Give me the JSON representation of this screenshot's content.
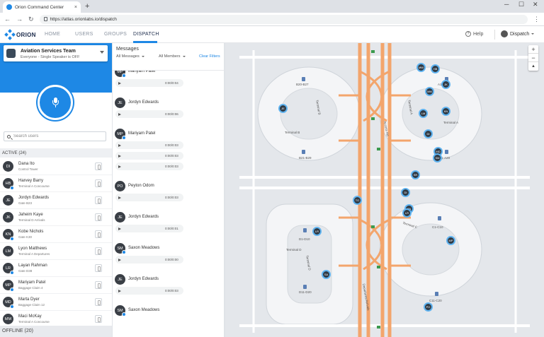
{
  "browser": {
    "tab_title": "Orion Command Center",
    "url": "https://atlas.orionlabs.io/dispatch",
    "new_tab": "+",
    "close_tab": "×"
  },
  "header": {
    "logo_text": "ORION",
    "nav": [
      "HOME",
      "USERS",
      "GROUPS",
      "DISPATCH"
    ],
    "help_label": "Help",
    "user_menu": "Dispatch"
  },
  "team": {
    "name": "Aviation Services Team",
    "subtitle": "Everyone - Single Speaker is OFF"
  },
  "search": {
    "placeholder": "Search users"
  },
  "sections": {
    "active": "ACTIVE (24)",
    "offline": "OFFLINE (20)"
  },
  "users": [
    {
      "initials": "DI",
      "name": "Dana Ito",
      "location": "Control Tower",
      "badge": false
    },
    {
      "initials": "HB",
      "name": "Harvey Barry",
      "location": "Terminal A Concourse",
      "badge": true
    },
    {
      "initials": "JE",
      "name": "Jordyn Edwards",
      "location": "Gate B23",
      "badge": false
    },
    {
      "initials": "JK",
      "name": "Jaheim Kaye",
      "location": "Terminal D Arrivals",
      "badge": false
    },
    {
      "initials": "KN",
      "name": "Kobe Nichols",
      "location": "Gate K30",
      "badge": true
    },
    {
      "initials": "LM",
      "name": "Lyon Matthews",
      "location": "Terminal A Departures",
      "badge": false
    },
    {
      "initials": "LR",
      "name": "Layan Rahman",
      "location": "Gate D38",
      "badge": true
    },
    {
      "initials": "MP",
      "name": "Mariyam Patel",
      "location": "Baggage Claim 4",
      "badge": true
    },
    {
      "initials": "MD",
      "name": "Marta Dyer",
      "location": "Baggage Claim 12",
      "badge": true
    },
    {
      "initials": "MM",
      "name": "Maci McKay",
      "location": "Terminal A Concourse",
      "badge": false
    }
  ],
  "messages": {
    "title": "Messages",
    "filter_messages": "All Messages",
    "filter_members": "All Members",
    "clear_filters": "Clear Filters",
    "items": [
      {
        "initials": "MP",
        "name": "Mariyam Patel",
        "badge": true,
        "players": [
          "0:00/0:04"
        ]
      },
      {
        "initials": "JE",
        "name": "Jordyn Edwards",
        "badge": false,
        "players": [
          "0:00/0:06"
        ]
      },
      {
        "initials": "MP",
        "name": "Mariyam Patel",
        "badge": true,
        "players": [
          "0:00/0:03",
          "0:00/0:03",
          "0:00/0:03"
        ]
      },
      {
        "initials": "PO",
        "name": "Peyton Odom",
        "badge": false,
        "players": [
          "0:00/0:03"
        ]
      },
      {
        "initials": "JE",
        "name": "Jordyn Edwards",
        "badge": false,
        "players": [
          "0:00/0:01"
        ]
      },
      {
        "initials": "SM",
        "name": "Saxon Meadows",
        "badge": true,
        "players": [
          "0:00/0:00"
        ]
      },
      {
        "initials": "JE",
        "name": "Jordyn Edwards",
        "badge": false,
        "players": [
          "0:00/0:03"
        ]
      },
      {
        "initials": "SM",
        "name": "Saxon Meadows",
        "badge": true,
        "players": []
      }
    ]
  },
  "map": {
    "zoom_in": "+",
    "zoom_out": "−",
    "compass": "▲",
    "labels": [
      "Terminal B",
      "Terminal A",
      "Terminal C",
      "Terminal D",
      "Access Rd",
      "Departures/Arrivals",
      "Terminal B",
      "Terminal A",
      "B20-B27",
      "B21-B29",
      "A1-A10",
      "A11-A20",
      "C1-C10",
      "C11-C20",
      "D1-D10",
      "D11-D20",
      "Terminal D"
    ],
    "markers": [
      "MW",
      "HB",
      "JK",
      "MM",
      "KN",
      "JE",
      "LM",
      "DI",
      "MD",
      "SM",
      "SR",
      "DI",
      "KN",
      "LR",
      "LR",
      "MP",
      "PO",
      "TO",
      "SA"
    ]
  },
  "colors": {
    "accent": "#1e88e5",
    "highway": "#f3a56c"
  }
}
